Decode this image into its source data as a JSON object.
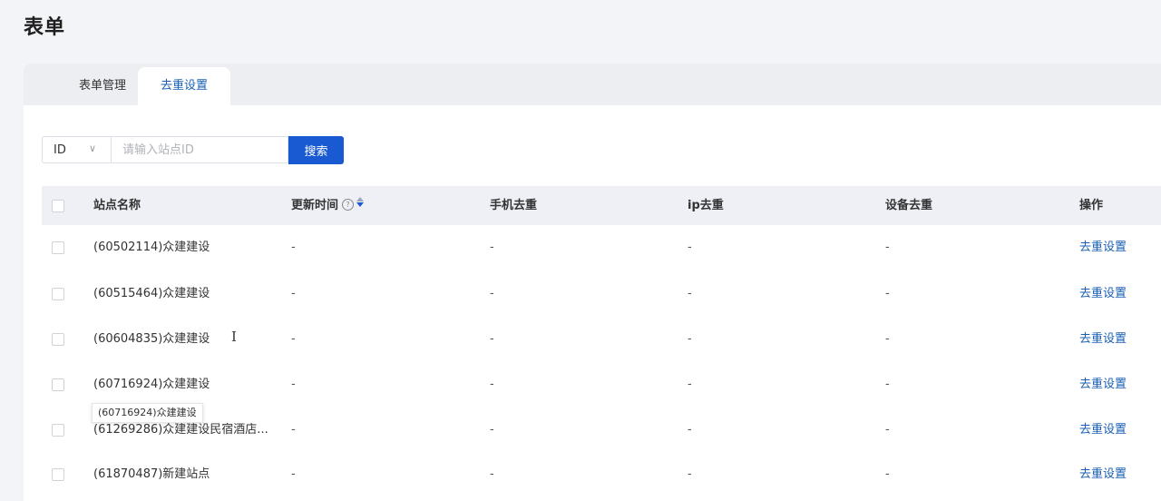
{
  "page": {
    "title": "表单"
  },
  "tabs": [
    {
      "label": "表单管理",
      "active": false
    },
    {
      "label": "去重设置",
      "active": true
    }
  ],
  "search": {
    "field_value": "ID",
    "placeholder": "请输入站点ID",
    "button_label": "搜索"
  },
  "table": {
    "headers": {
      "name": "站点名称",
      "updated": "更新时间",
      "phone": "手机去重",
      "ip": "ip去重",
      "device": "设备去重",
      "action": "操作"
    },
    "rows": [
      {
        "name": "(60502114)众建建设",
        "updated": "-",
        "phone": "-",
        "ip": "-",
        "device": "-",
        "action": "去重设置"
      },
      {
        "name": "(60515464)众建建设",
        "updated": "-",
        "phone": "-",
        "ip": "-",
        "device": "-",
        "action": "去重设置"
      },
      {
        "name": "(60604835)众建建设",
        "updated": "-",
        "phone": "-",
        "ip": "-",
        "device": "-",
        "action": "去重设置"
      },
      {
        "name": "(60716924)众建建设",
        "updated": "-",
        "phone": "-",
        "ip": "-",
        "device": "-",
        "action": "去重设置"
      },
      {
        "name": "(61269286)众建建设民宿酒店...",
        "updated": "-",
        "phone": "-",
        "ip": "-",
        "device": "-",
        "action": "去重设置"
      },
      {
        "name": "(61870487)新建站点",
        "updated": "-",
        "phone": "-",
        "ip": "-",
        "device": "-",
        "action": "去重设置"
      }
    ]
  },
  "tooltip": {
    "text": "(60716924)众建建设"
  },
  "icons": {
    "chevron": "chevron-down-icon",
    "help": "help-circle-icon",
    "sort": "sort-icon",
    "cursor": "text-cursor-icon"
  },
  "colors": {
    "accent": "#1959d1",
    "link": "#1a5fb4",
    "header_bg": "#eef0f6",
    "page_bg": "#f3f4f7"
  }
}
